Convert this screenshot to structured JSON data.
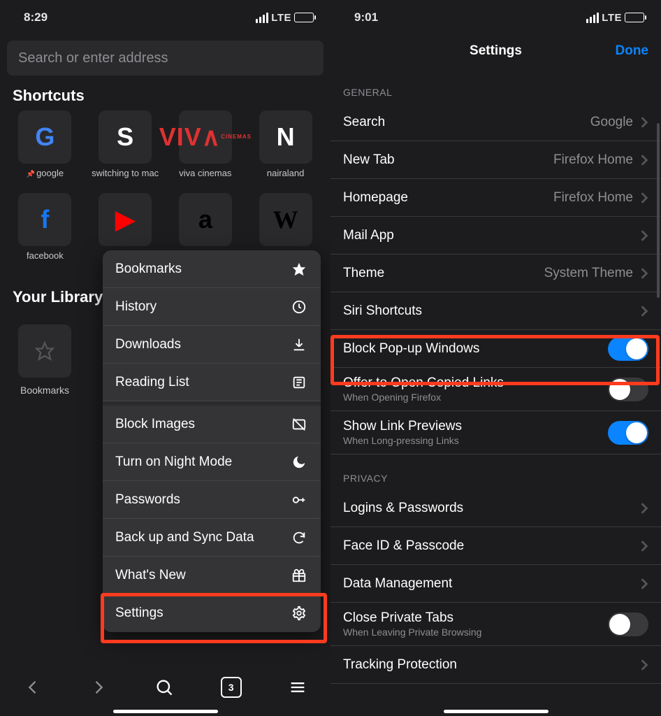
{
  "left": {
    "status": {
      "time": "8:29",
      "net": "LTE"
    },
    "search_placeholder": "Search or enter address",
    "shortcuts_title": "Shortcuts",
    "shortcuts": [
      {
        "label": "google",
        "pinned": true,
        "glyph": "G",
        "cls": "ggl"
      },
      {
        "label": "switching to mac",
        "glyph": "S",
        "cls": "sw"
      },
      {
        "label": "viva cinemas",
        "glyph": "VIVA",
        "cls": "viva"
      },
      {
        "label": "nairaland",
        "glyph": "N",
        "cls": "nl"
      },
      {
        "label": "facebook",
        "glyph": "f",
        "cls": "fb"
      },
      {
        "label": "",
        "glyph": "▶",
        "cls": "yt"
      },
      {
        "label": "",
        "glyph": "a",
        "cls": "amz"
      },
      {
        "label": "",
        "glyph": "W",
        "cls": "wk"
      }
    ],
    "library_title": "Your Library",
    "library_item": "Bookmarks",
    "menu": {
      "bookmarks": "Bookmarks",
      "history": "History",
      "downloads": "Downloads",
      "reading": "Reading List",
      "block_images": "Block Images",
      "night": "Turn on Night Mode",
      "passwords": "Passwords",
      "backup": "Back up and Sync Data",
      "whatsnew": "What's New",
      "settings": "Settings"
    },
    "bottom": {
      "tab_count": "3",
      "glyph_o": "O"
    }
  },
  "right": {
    "status": {
      "time": "9:01",
      "net": "LTE"
    },
    "header": {
      "title": "Settings",
      "done": "Done"
    },
    "sections": {
      "general": "GENERAL",
      "privacy": "PRIVACY"
    },
    "cells": {
      "search": {
        "label": "Search",
        "value": "Google"
      },
      "newtab": {
        "label": "New Tab",
        "value": "Firefox Home"
      },
      "homepage": {
        "label": "Homepage",
        "value": "Firefox Home"
      },
      "mail": {
        "label": "Mail App"
      },
      "theme": {
        "label": "Theme",
        "value": "System Theme"
      },
      "siri": {
        "label": "Siri Shortcuts"
      },
      "popup": {
        "label": "Block Pop-up Windows",
        "on": true
      },
      "copied": {
        "label": "Offer to Open Copied Links",
        "sub": "When Opening Firefox",
        "on": false
      },
      "previews": {
        "label": "Show Link Previews",
        "sub": "When Long-pressing Links",
        "on": true
      },
      "logins": {
        "label": "Logins & Passwords"
      },
      "faceid": {
        "label": "Face ID & Passcode"
      },
      "datamg": {
        "label": "Data Management"
      },
      "closepriv": {
        "label": "Close Private Tabs",
        "sub": "When Leaving Private Browsing",
        "on": false
      },
      "tracking": {
        "label": "Tracking Protection"
      }
    }
  }
}
